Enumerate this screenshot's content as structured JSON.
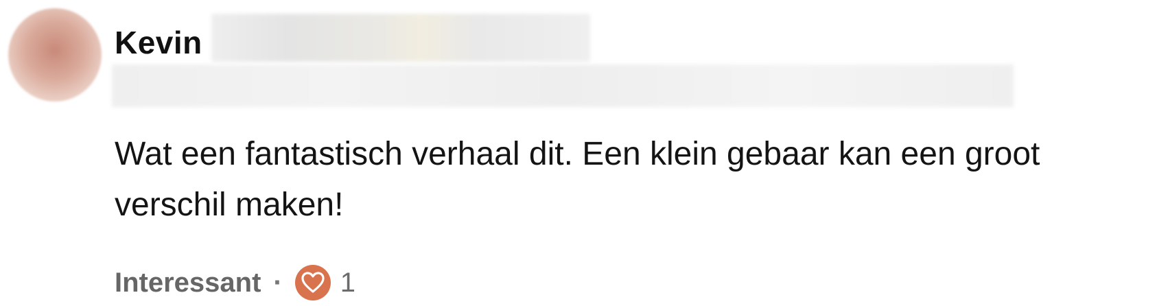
{
  "comment": {
    "author_name": "Kevin",
    "body": "Wat een fantastisch verhaal dit. Een klein gebaar kan een groot verschil maken!",
    "reaction_label": "Interessant",
    "separator": "·",
    "reaction_icon": "heart-icon",
    "reaction_count": "1",
    "colors": {
      "heart_badge": "#d9734e",
      "meta_text": "#6b6b6b"
    }
  }
}
